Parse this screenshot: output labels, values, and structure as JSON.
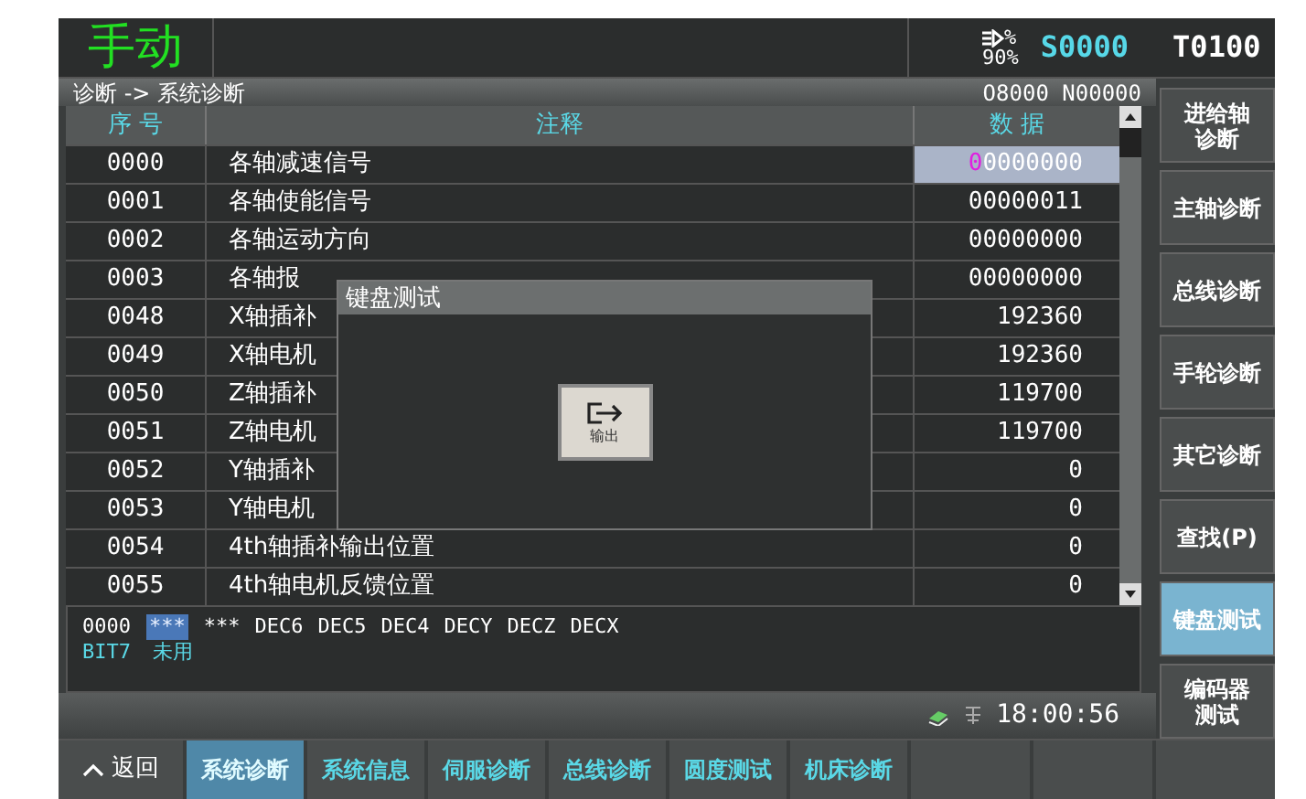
{
  "header": {
    "mode": "手动",
    "feed_unit": "%",
    "feed_rate": "90%",
    "spindle": "S0000",
    "tool": "T0100"
  },
  "breadcrumb": {
    "path": "诊断 -> 系统诊断",
    "program": "O8000 N00000"
  },
  "table": {
    "columns": [
      "序 号",
      "注释",
      "数 据"
    ],
    "rows": [
      {
        "no": "0000",
        "note": "各轴减速信号",
        "data": "00000000",
        "selected": true
      },
      {
        "no": "0001",
        "note": "各轴使能信号",
        "data": "00000011",
        "selected": false
      },
      {
        "no": "0002",
        "note": "各轴运动方向",
        "data": "00000000",
        "selected": false
      },
      {
        "no": "0003",
        "note": "各轴报",
        "data": "00000000",
        "selected": false
      },
      {
        "no": "0048",
        "note": "X轴插补",
        "data": "192360",
        "selected": false
      },
      {
        "no": "0049",
        "note": "X轴电机",
        "data": "192360",
        "selected": false
      },
      {
        "no": "0050",
        "note": "Z轴插补",
        "data": "119700",
        "selected": false
      },
      {
        "no": "0051",
        "note": "Z轴电机",
        "data": "119700",
        "selected": false
      },
      {
        "no": "0052",
        "note": "Y轴插补",
        "data": "0",
        "selected": false
      },
      {
        "no": "0053",
        "note": "Y轴电机",
        "data": "0",
        "selected": false
      },
      {
        "no": "0054",
        "note": "4th轴插补输出位置",
        "data": "0",
        "selected": false
      },
      {
        "no": "0055",
        "note": "4th轴电机反馈位置",
        "data": "0",
        "selected": false
      }
    ]
  },
  "dialog": {
    "title": "键盘测试",
    "button": "输出"
  },
  "info": {
    "address": "0000",
    "bits": [
      {
        "text": "***",
        "selected": true
      },
      {
        "text": "***",
        "selected": false
      },
      {
        "text": "DEC6",
        "selected": false
      },
      {
        "text": "DEC5",
        "selected": false
      },
      {
        "text": "DEC4",
        "selected": false
      },
      {
        "text": "DECY",
        "selected": false
      },
      {
        "text": "DECZ",
        "selected": false
      },
      {
        "text": "DECX",
        "selected": false
      }
    ],
    "bit": "BIT7",
    "bit_desc": "未用"
  },
  "status": {
    "time": "18:00:56"
  },
  "sidebar": [
    {
      "lines": [
        "进给轴",
        "诊断"
      ],
      "selected": false
    },
    {
      "lines": [
        "主轴诊断"
      ],
      "selected": false
    },
    {
      "lines": [
        "总线诊断"
      ],
      "selected": false
    },
    {
      "lines": [
        "手轮诊断"
      ],
      "selected": false
    },
    {
      "lines": [
        "其它诊断"
      ],
      "selected": false
    },
    {
      "lines": [
        "查找(P)"
      ],
      "selected": false
    },
    {
      "lines": [
        "键盘测试"
      ],
      "selected": true
    },
    {
      "lines": [
        "编码器",
        "测试"
      ],
      "selected": false
    }
  ],
  "bottom_tabs": {
    "back": "返回",
    "tabs": [
      {
        "label": "系统诊断",
        "selected": true
      },
      {
        "label": "系统信息",
        "selected": false
      },
      {
        "label": "伺服诊断",
        "selected": false
      },
      {
        "label": "总线诊断",
        "selected": false
      },
      {
        "label": "圆度测试",
        "selected": false
      },
      {
        "label": "机床诊断",
        "selected": false
      }
    ]
  }
}
